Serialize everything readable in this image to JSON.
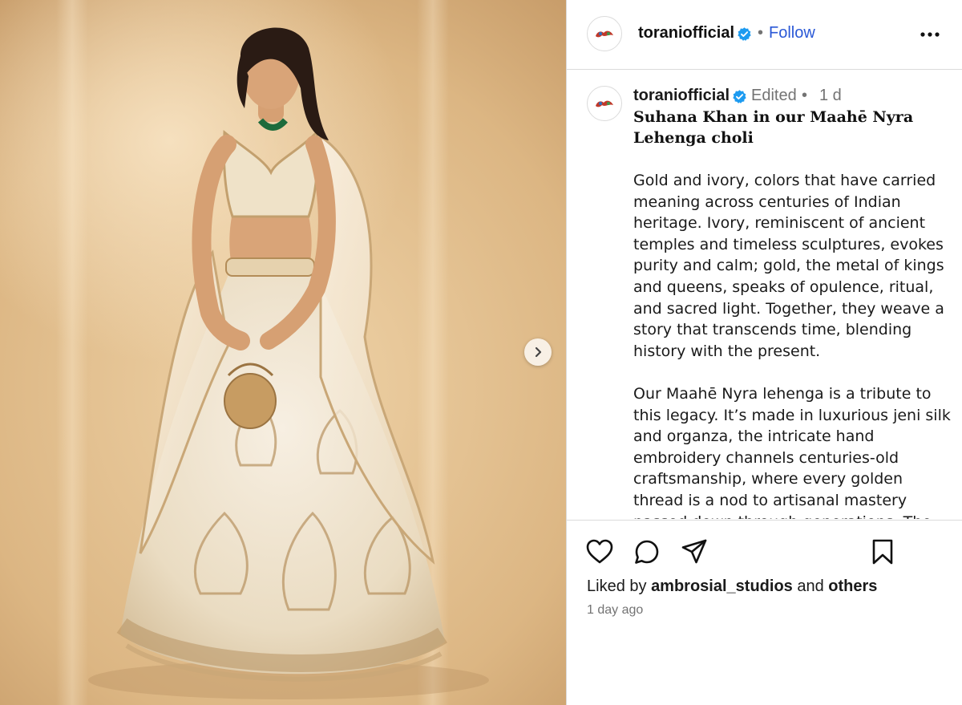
{
  "post": {
    "username": "toraniofficial",
    "follow_label": "Follow",
    "separator": "•",
    "caption": {
      "username": "toraniofficial",
      "edited_label": "Edited",
      "separator": "•",
      "time": "1 d",
      "title": "Suhana Khan in our Maahē Nyra Lehenga choli",
      "paragraph_1": "Gold and ivory, colors that have carried meaning across centuries of Indian heritage. Ivory, reminiscent of ancient temples and timeless sculptures, evokes purity and calm; gold, the metal of kings and queens, speaks of opulence, ritual, and sacred light. Together, they weave a story that transcends time, blending history with the present.",
      "paragraph_2": "Our Maahē Nyra lehenga is a tribute to this legacy. It’s made in luxurious jeni silk and organza, the intricate hand embroidery channels centuries-old craftsmanship, where every golden thread is a nod to artisanal mastery passed down through generations. The serene ivory"
    },
    "likes": {
      "prefix": "Liked by",
      "user": "ambrosial_studios",
      "conjunction": "and",
      "others": "others"
    },
    "posted_time": "1 day ago"
  },
  "icons": {
    "verified": "verified-badge-icon",
    "more": "more-options-icon",
    "next": "chevron-right-icon",
    "like": "heart-icon",
    "comment": "comment-bubble-icon",
    "share": "paper-plane-icon",
    "save": "bookmark-icon"
  },
  "colors": {
    "follow": "#2a58d6",
    "verified": "#1d9bf0",
    "muted": "#737373",
    "photo_backdrop": "#e6c497",
    "lehenga": "#f1e7d6"
  }
}
